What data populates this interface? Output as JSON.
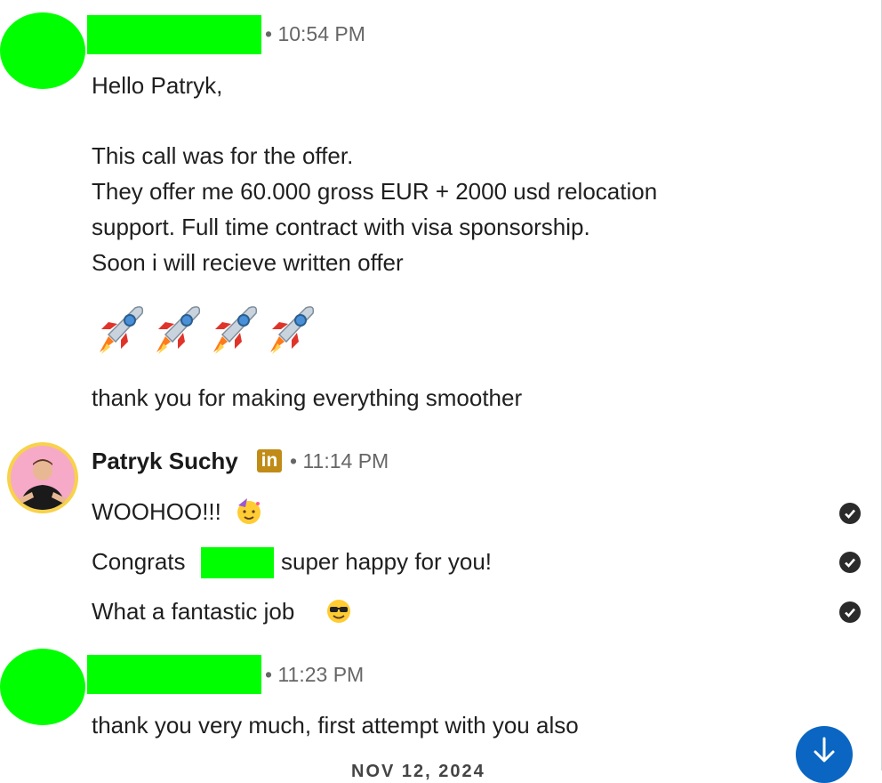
{
  "colors": {
    "redaction": "#00ff00",
    "meta_text": "#666666",
    "link_blue": "#0a66c2",
    "linkedin_badge": "#c08b17"
  },
  "messages": [
    {
      "sender_redacted": true,
      "time": "10:54 PM",
      "lines": [
        "Hello Patryk,",
        "This call was for the offer.",
        "They offer me 60.000 gross EUR + 2000 usd relocation",
        "support. Full time contract with visa sponsorship.",
        "Soon i will recieve written offer",
        "thank you for making everything smoother"
      ],
      "emoji_row": [
        "rocket-emoji",
        "rocket-emoji",
        "rocket-emoji",
        "rocket-emoji"
      ]
    },
    {
      "sender": "Patryk Suchy",
      "badge": "in",
      "time": "11:14 PM",
      "lines": [
        "WOOHOO!!!",
        "Congrats",
        "super happy for you!",
        "What a fantastic job"
      ],
      "emojis": [
        "partying-face-emoji",
        "sunglasses-face-emoji"
      ],
      "status_icon": "check-circle-icon"
    },
    {
      "sender_redacted": true,
      "time": "11:23 PM",
      "lines": [
        "thank you very much, first attempt with you also"
      ]
    }
  ],
  "separator": "•",
  "date_divider": "NOV 12, 2024",
  "scroll_button_icon": "arrow-down-icon"
}
